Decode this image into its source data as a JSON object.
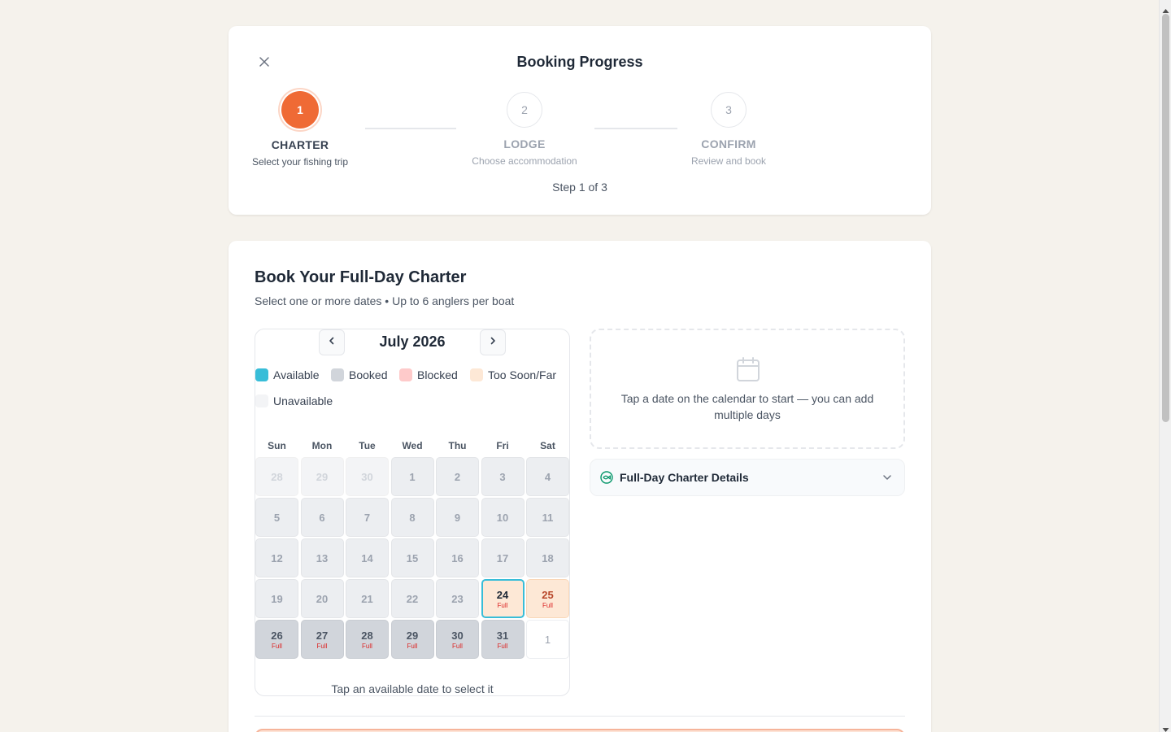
{
  "progress": {
    "title": "Booking Progress",
    "steps": [
      {
        "number": "1",
        "name": "CHARTER",
        "subtitle": "Select your fishing trip"
      },
      {
        "number": "2",
        "name": "LODGE",
        "subtitle": "Choose accommodation"
      },
      {
        "number": "3",
        "name": "CONFIRM",
        "subtitle": "Review and book"
      }
    ],
    "step_count": "Step 1 of 3"
  },
  "booking": {
    "title": "Book Your Full-Day Charter",
    "subtitle": "Select one or more dates • Up to 6 anglers per boat"
  },
  "calendar": {
    "month": "July 2026",
    "legend": [
      {
        "label": "Available",
        "color": "#38bdd8"
      },
      {
        "label": "Booked",
        "color": "#d1d5db"
      },
      {
        "label": "Blocked",
        "color": "#fecaca"
      },
      {
        "label": "Too Soon/Far",
        "color": "#fde8d6"
      },
      {
        "label": "Unavailable",
        "color": "#f3f4f6"
      }
    ],
    "weekdays": [
      "Sun",
      "Mon",
      "Tue",
      "Wed",
      "Thu",
      "Fri",
      "Sat"
    ],
    "days": [
      {
        "n": "28",
        "s": "muted",
        "tag": ""
      },
      {
        "n": "29",
        "s": "muted",
        "tag": ""
      },
      {
        "n": "30",
        "s": "muted",
        "tag": ""
      },
      {
        "n": "1",
        "s": "unavail",
        "tag": ""
      },
      {
        "n": "2",
        "s": "unavail",
        "tag": ""
      },
      {
        "n": "3",
        "s": "unavail",
        "tag": ""
      },
      {
        "n": "4",
        "s": "unavail",
        "tag": ""
      },
      {
        "n": "5",
        "s": "unavail",
        "tag": ""
      },
      {
        "n": "6",
        "s": "unavail",
        "tag": ""
      },
      {
        "n": "7",
        "s": "unavail",
        "tag": ""
      },
      {
        "n": "8",
        "s": "unavail",
        "tag": ""
      },
      {
        "n": "9",
        "s": "unavail",
        "tag": ""
      },
      {
        "n": "10",
        "s": "unavail",
        "tag": ""
      },
      {
        "n": "11",
        "s": "unavail",
        "tag": ""
      },
      {
        "n": "12",
        "s": "unavail",
        "tag": ""
      },
      {
        "n": "13",
        "s": "unavail",
        "tag": ""
      },
      {
        "n": "14",
        "s": "unavail",
        "tag": ""
      },
      {
        "n": "15",
        "s": "unavail",
        "tag": ""
      },
      {
        "n": "16",
        "s": "unavail",
        "tag": ""
      },
      {
        "n": "17",
        "s": "unavail",
        "tag": ""
      },
      {
        "n": "18",
        "s": "unavail",
        "tag": ""
      },
      {
        "n": "19",
        "s": "unavail",
        "tag": ""
      },
      {
        "n": "20",
        "s": "unavail",
        "tag": ""
      },
      {
        "n": "21",
        "s": "unavail",
        "tag": ""
      },
      {
        "n": "22",
        "s": "unavail",
        "tag": ""
      },
      {
        "n": "23",
        "s": "unavail",
        "tag": ""
      },
      {
        "n": "24",
        "s": "today",
        "tag": "Full"
      },
      {
        "n": "25",
        "s": "toosoon",
        "tag": "Full"
      },
      {
        "n": "26",
        "s": "booked",
        "tag": "Full"
      },
      {
        "n": "27",
        "s": "booked",
        "tag": "Full"
      },
      {
        "n": "28",
        "s": "booked",
        "tag": "Full"
      },
      {
        "n": "29",
        "s": "booked",
        "tag": "Full"
      },
      {
        "n": "30",
        "s": "booked",
        "tag": "Full"
      },
      {
        "n": "31",
        "s": "booked",
        "tag": "Full"
      },
      {
        "n": "1",
        "s": "next-month",
        "tag": ""
      }
    ],
    "hint": "Tap an available date to select it"
  },
  "info": {
    "text": "Tap a date on the calendar to start — you can add multiple days"
  },
  "details": {
    "title": "Full-Day Charter Details"
  },
  "colors": {
    "accent": "#ef6a35",
    "available": "#38bdd8"
  }
}
